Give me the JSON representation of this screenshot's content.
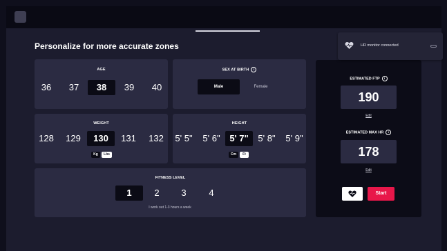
{
  "header": {
    "title": "Personalize for more accurate zones"
  },
  "age": {
    "label": "AGE",
    "options": [
      "36",
      "37",
      "38",
      "39",
      "40"
    ],
    "selected": "38"
  },
  "sex": {
    "label": "SEX AT BIRTH",
    "options": [
      "Male",
      "Female"
    ],
    "selected": "Male"
  },
  "weight": {
    "label": "WEIGHT",
    "options": [
      "128",
      "129",
      "130",
      "131",
      "132"
    ],
    "selected": "130",
    "units": [
      "Kg",
      "Lbs"
    ],
    "selected_unit": "Lbs"
  },
  "height": {
    "label": "HEIGHT",
    "options": [
      "5' 5\"",
      "5' 6\"",
      "5' 7\"",
      "5' 8\"",
      "5' 9\""
    ],
    "selected": "5' 7\"",
    "units": [
      "Cm",
      "Ft"
    ],
    "selected_unit": "Ft"
  },
  "fitness": {
    "label": "FITNESS LEVEL",
    "options": [
      "1",
      "2",
      "3",
      "4"
    ],
    "selected": "1",
    "description": "I work out 1-3 hours a week"
  },
  "estimates": {
    "ftp_label": "ESTIMATED FTP",
    "ftp_value": "190",
    "ftp_edit": "Edit",
    "hr_label": "ESTIMATED MAX HR",
    "hr_value": "178",
    "hr_edit": "Edit"
  },
  "actions": {
    "start_label": "Start"
  },
  "toast": {
    "text": "HR monitor connected"
  },
  "colors": {
    "accent": "#e8174a",
    "background": "#1c1c2e",
    "card": "#2b2b42",
    "selected": "#0b0b15"
  }
}
